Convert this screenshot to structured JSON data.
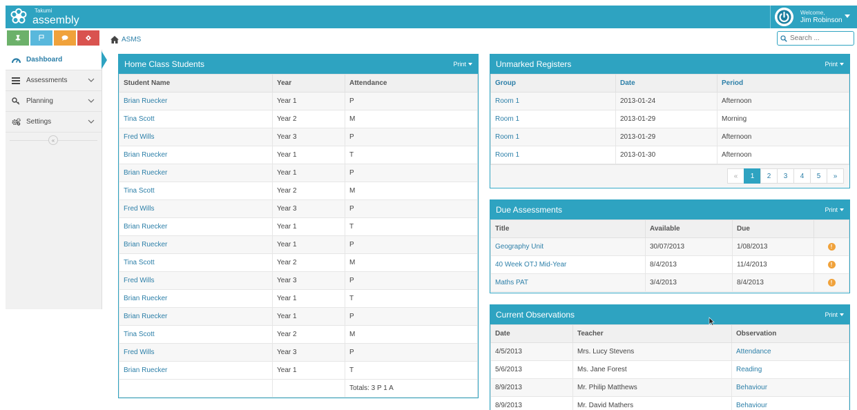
{
  "app": {
    "brand_small": "Takumi",
    "brand_name": "assembly"
  },
  "user": {
    "welcome": "Welcome,",
    "name": "Jim Robinson"
  },
  "quick_buttons": [
    "pin-icon",
    "flag-icon",
    "comment-icon",
    "tag-icon"
  ],
  "breadcrumb": {
    "label": "ASMS"
  },
  "search": {
    "placeholder": "Search ..."
  },
  "sidebar": {
    "items": [
      {
        "label": "Dashboard",
        "icon": "dashboard-icon"
      },
      {
        "label": "Assessments",
        "icon": "list-icon"
      },
      {
        "label": "Planning",
        "icon": "search-key-icon"
      },
      {
        "label": "Settings",
        "icon": "cogs-icon"
      }
    ],
    "collapse": "«"
  },
  "print_label": "Print",
  "home_class": {
    "title": "Home Class Students",
    "columns": [
      "Student Name",
      "Year",
      "Attendance"
    ],
    "rows": [
      [
        "Brian Ruecker",
        "Year 1",
        "P"
      ],
      [
        "Tina Scott",
        "Year 2",
        "M"
      ],
      [
        "Fred Wills",
        "Year 3",
        "P"
      ],
      [
        "Brian Ruecker",
        "Year 1",
        "T"
      ],
      [
        "Brian Ruecker",
        "Year 1",
        "P"
      ],
      [
        "Tina Scott",
        "Year 2",
        "M"
      ],
      [
        "Fred Wills",
        "Year 3",
        "P"
      ],
      [
        "Brian Ruecker",
        "Year 1",
        "T"
      ],
      [
        "Brian Ruecker",
        "Year 1",
        "P"
      ],
      [
        "Tina Scott",
        "Year 2",
        "M"
      ],
      [
        "Fred Wills",
        "Year 3",
        "P"
      ],
      [
        "Brian Ruecker",
        "Year 1",
        "T"
      ],
      [
        "Brian Ruecker",
        "Year 1",
        "P"
      ],
      [
        "Tina Scott",
        "Year 2",
        "M"
      ],
      [
        "Fred Wills",
        "Year 3",
        "P"
      ],
      [
        "Brian Ruecker",
        "Year 1",
        "T"
      ]
    ],
    "totals": "Totals: 3 P 1 A"
  },
  "unmarked": {
    "title": "Unmarked Registers",
    "columns": [
      "Group",
      "Date",
      "Period"
    ],
    "rows": [
      [
        "Room 1",
        "2013-01-24",
        "Afternoon"
      ],
      [
        "Room 1",
        "2013-01-29",
        "Morning"
      ],
      [
        "Room 1",
        "2013-01-29",
        "Afternoon"
      ],
      [
        "Room 1",
        "2013-01-30",
        "Afternoon"
      ]
    ],
    "pages": [
      "«",
      "1",
      "2",
      "3",
      "4",
      "5",
      "»"
    ],
    "active_page": "1"
  },
  "due": {
    "title": "Due Assessments",
    "columns": [
      "Title",
      "Available",
      "Due",
      ""
    ],
    "rows": [
      [
        "Geography Unit",
        "30/07/2013",
        "1/08/2013"
      ],
      [
        "40 Week OTJ Mid-Year",
        "8/4/2013",
        "11/4/2013"
      ],
      [
        "Maths PAT",
        "3/4/2013",
        "8/4/2013"
      ]
    ],
    "warn_glyph": "!"
  },
  "observations": {
    "title": "Current Observations",
    "columns": [
      "Date",
      "Teacher",
      "Observation"
    ],
    "rows": [
      [
        "4/5/2013",
        "Mrs. Lucy Stevens",
        "Attendance"
      ],
      [
        "5/6/2013",
        "Ms. Jane Forest",
        "Reading"
      ],
      [
        "8/9/2013",
        "Mr. Philip Matthews",
        "Behaviour"
      ],
      [
        "8/9/2013",
        "Mr. David Mathers",
        "Behaviour"
      ]
    ]
  },
  "colors": {
    "accent": "#2ea3c1",
    "link": "#2c7fa8",
    "warn": "#f0a23b"
  }
}
